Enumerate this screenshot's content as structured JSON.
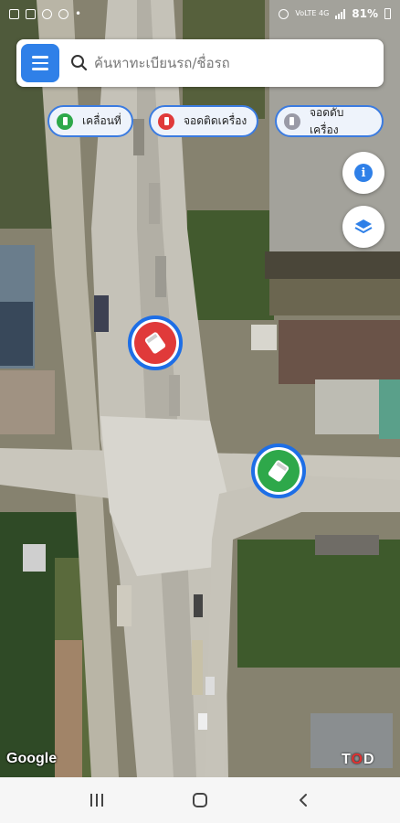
{
  "status_bar": {
    "battery": "81%",
    "network": "VoLTE 4G"
  },
  "search": {
    "placeholder": "ค้นหาทะเบียนรถ/ชื่อรถ",
    "menu_icon": "hamburger-menu-icon",
    "search_icon": "search-icon"
  },
  "filters": [
    {
      "label": "เคลื่อนที่",
      "color": "#2ea84a"
    },
    {
      "label": "จอดติดเครื่อง",
      "color": "#e03a3a"
    },
    {
      "label": "จอดดับเครื่อง",
      "color": "#9a9aa6"
    }
  ],
  "map_controls": {
    "info_glyph": "i",
    "info_icon": "info-icon",
    "layers_icon": "layers-icon",
    "accent_color": "#2f80e8"
  },
  "vehicles": [
    {
      "status": "idle",
      "color": "#e03a3a"
    },
    {
      "status": "moving",
      "color": "#2ea84a"
    }
  ],
  "attribution": {
    "google": "Google",
    "tod_prefix": "T",
    "tod_o": "O",
    "tod_suffix": "D"
  },
  "nav_bar": {
    "recents_icon": "recents-icon",
    "home_icon": "home-icon",
    "back_icon": "back-icon"
  }
}
